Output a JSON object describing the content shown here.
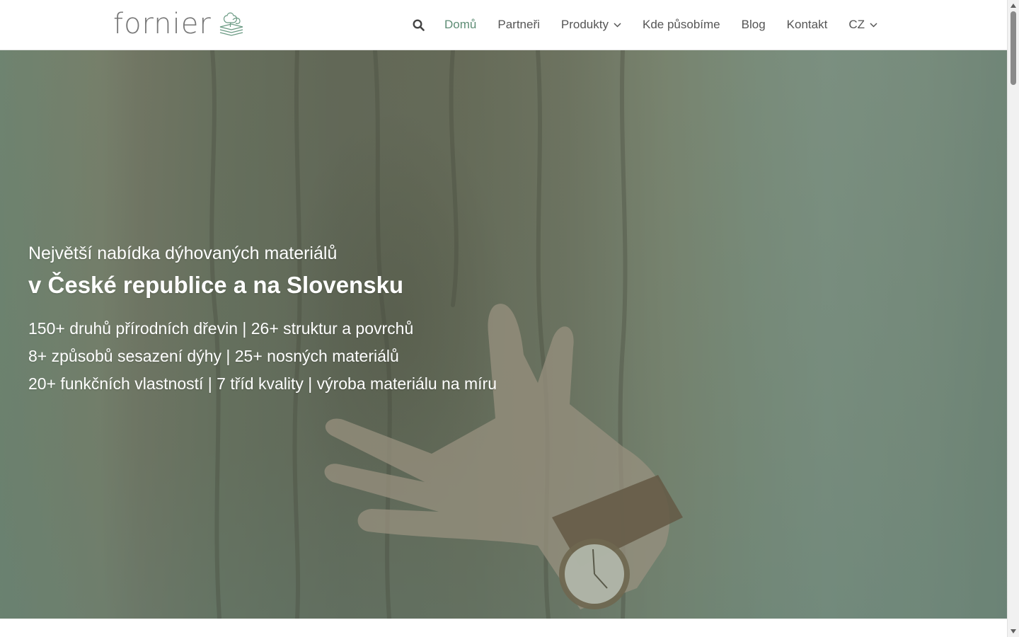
{
  "brand": {
    "name": "fornier",
    "logo_icon": "tree-on-veneer-layers-icon"
  },
  "nav": {
    "search_icon": "search-icon",
    "items": [
      {
        "label": "Domů",
        "active": true
      },
      {
        "label": "Partneři"
      },
      {
        "label": "Produkty",
        "dropdown": true
      },
      {
        "label": "Kde působíme"
      },
      {
        "label": "Blog"
      },
      {
        "label": "Kontakt"
      },
      {
        "label": "CZ",
        "dropdown": true
      }
    ],
    "accent_color": "#5e8d75",
    "text_color": "#555555"
  },
  "hero": {
    "subtitle": "Největší nabídka dýhovaných materiálů",
    "title": "v České republice a na Slovensku",
    "stats": [
      "150+ druhů přírodních dřevin | 26+ struktur a povrchů",
      "8+ způsobů sesazení dýhy | 25+ nosných materiálů",
      "20+ funkčních vlastností | 7 tříd kvality | výroba materiálu na míru"
    ],
    "overlay_color": "#587a6a",
    "image": "hand-on-tree-bark-with-wristwatch"
  }
}
